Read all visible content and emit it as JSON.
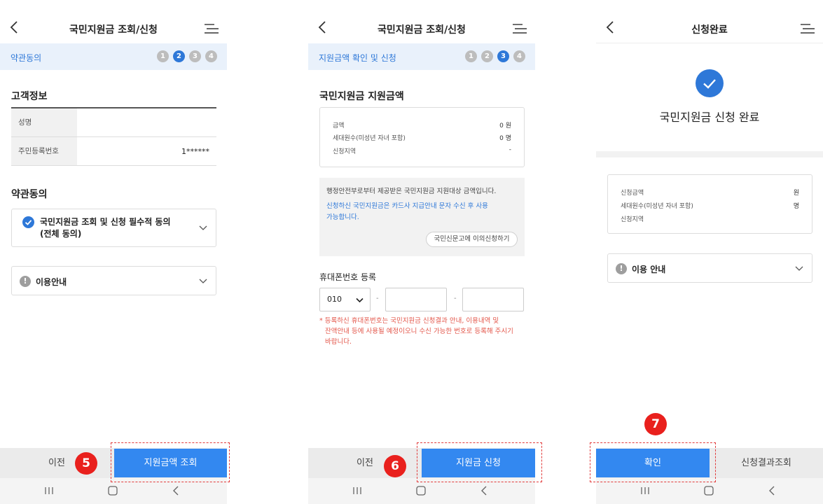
{
  "screens": [
    {
      "title": "국민지원금 조회/신청",
      "step_name": "약관동의",
      "steps": [
        "1",
        "2",
        "3",
        "4"
      ],
      "active_step": 2,
      "customer_section": "고객정보",
      "customer_rows": [
        {
          "label": "성명",
          "value": ""
        },
        {
          "label": "주민등록번호",
          "value": "1******"
        }
      ],
      "terms_section": "약관동의",
      "terms_item": {
        "line1": "국민지원금 조회 및 신청 필수적 동의",
        "line2": "(전체 동의)"
      },
      "usage_info": "이용안내",
      "prev_label": "이전",
      "primary_label": "지원금액 조회",
      "badge": "5"
    },
    {
      "title": "국민지원금 조회/신청",
      "step_name": "지원금액 확인 및 신청",
      "steps": [
        "1",
        "2",
        "3",
        "4"
      ],
      "active_step": 3,
      "amount_section": "국민지원금 지원금액",
      "amount_rows": [
        {
          "label": "금액",
          "value": "0 원"
        },
        {
          "label": "세대원수(미성년 자녀 포함)",
          "value": "0 명"
        },
        {
          "label": "신청지역",
          "value": "-"
        }
      ],
      "notice_line1": "행정안전부로부터 제공받은 국민지원금 지원대상 금액입니다.",
      "notice_blue1": "신청하신 국민지원금은 카드사 지급안내 문자 수신 후 사용",
      "notice_blue2": "가능합니다.",
      "objection_label": "국민신문고에 이의신청하기",
      "phone_section": "휴대폰번호 등록",
      "phone_prefix": "010",
      "phone_dash": "-",
      "warn1": "* 등록하신 휴대폰번호는 국민지원금 신청결과 안내, 이용내역 및",
      "warn2": "잔액안내 등에 사용될 예정이오니 수신 가능한 번호로 등록해 주시기",
      "warn3": "바랍니다.",
      "prev_label": "이전",
      "primary_label": "지원금 신청",
      "badge": "6"
    },
    {
      "title": "신청완료",
      "complete_text": "국민지원금 신청 완료",
      "result_rows": [
        {
          "label": "신청금액",
          "value": "원"
        },
        {
          "label": "세대원수(미성년 자녀 포함)",
          "value": "명"
        },
        {
          "label": "신청지역",
          "value": ""
        }
      ],
      "usage_info": "이용 안내",
      "confirm_label": "확인",
      "result_label": "신청결과조회",
      "badge": "7"
    }
  ],
  "colors": {
    "accent": "#3388f0",
    "step_active": "#2e78d8",
    "badge": "#e9201d",
    "warning": "#e3564a"
  },
  "icons": [
    "back-arrow-icon",
    "menu-icon",
    "check-icon",
    "alert-icon",
    "chevron-down-icon",
    "recent-apps-icon",
    "home-icon",
    "nav-back-icon"
  ]
}
